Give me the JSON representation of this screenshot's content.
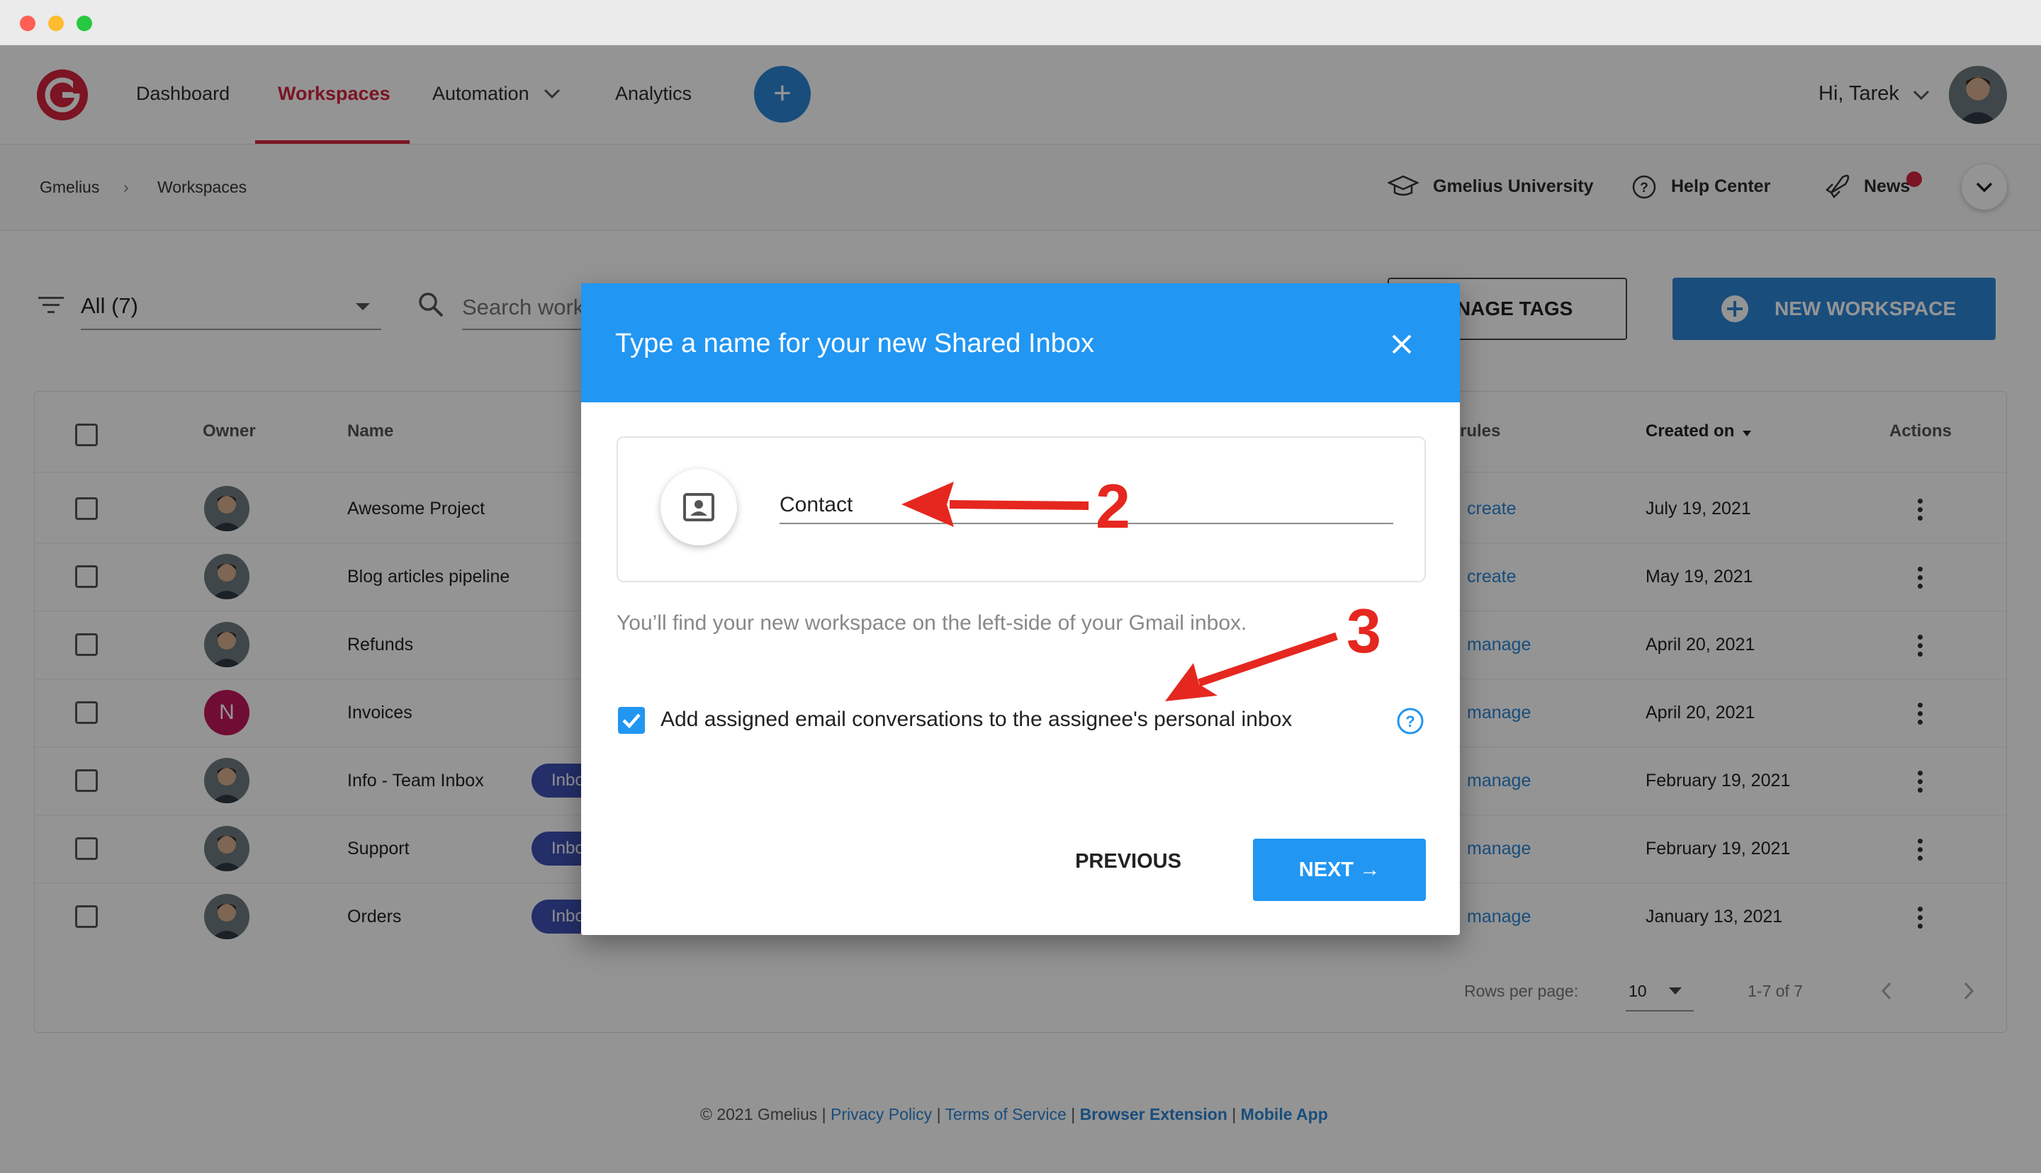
{
  "window": {
    "traffic_lights": [
      "#ff5f57",
      "#febc2e",
      "#28c840"
    ]
  },
  "header": {
    "nav": [
      {
        "label": "Dashboard"
      },
      {
        "label": "Workspaces"
      },
      {
        "label": "Automation"
      },
      {
        "label": "Analytics"
      }
    ],
    "add_button": "+",
    "greeting": "Hi, Tarek"
  },
  "breadcrumb": [
    "Gmelius",
    "Workspaces"
  ],
  "help_links": {
    "university": "Gmelius University",
    "help_center": "Help Center",
    "news": "News"
  },
  "toolbar": {
    "filter_value": "All (7)",
    "search_placeholder": "Search work",
    "manage_tags": "ANAGE TAGS",
    "new_workspace": "NEW WORKSPACE"
  },
  "table": {
    "headers": {
      "owner": "Owner",
      "name": "Name",
      "rules": "rules",
      "created": "Created on",
      "actions": "Actions"
    },
    "rows": [
      {
        "name": "Awesome Project",
        "owner": "photo",
        "tag": "",
        "rule": "create",
        "created": "July 19, 2021"
      },
      {
        "name": "Blog articles pipeline",
        "owner": "photo",
        "tag": "",
        "rule": "create",
        "created": "May 19, 2021"
      },
      {
        "name": "Refunds",
        "owner": "photo",
        "tag": "",
        "rule": "manage",
        "created": "April 20, 2021"
      },
      {
        "name": "Invoices",
        "owner": "N",
        "tag": "",
        "rule": "manage",
        "created": "April 20, 2021"
      },
      {
        "name": "Info - Team Inbox",
        "owner": "photo",
        "tag": "Inbo",
        "rule": "manage",
        "created": "February 19, 2021"
      },
      {
        "name": "Support",
        "owner": "photo",
        "tag": "Inbo",
        "rule": "manage",
        "created": "February 19, 2021"
      },
      {
        "name": "Orders",
        "owner": "photo",
        "tag": "Inbo",
        "rule": "manage",
        "created": "January 13, 2021"
      }
    ],
    "rows_per_page_label": "Rows per page:",
    "rows_per_page": "10",
    "range": "1-7 of 7"
  },
  "footer": {
    "copyright": "© 2021 Gmelius |",
    "privacy": "Privacy Policy",
    "terms": "Terms of Service",
    "extension": "Browser Extension",
    "mobile": "Mobile App",
    "sep": "|"
  },
  "dialog": {
    "title": "Type a name for your new Shared Inbox",
    "name_value": "Contact",
    "hint": "You’ll find your new workspace on the left-side of your Gmail inbox.",
    "checkbox_label": "Add assigned email conversations to the assignee's personal inbox",
    "checkbox_checked": true,
    "previous": "PREVIOUS",
    "next": "NEXT →"
  },
  "annotations": {
    "step2": "2",
    "step3": "3",
    "color": "#e5271f"
  },
  "colors": {
    "brand": "#d4233d",
    "primary": "#2196f3",
    "link": "#2b86d6"
  }
}
